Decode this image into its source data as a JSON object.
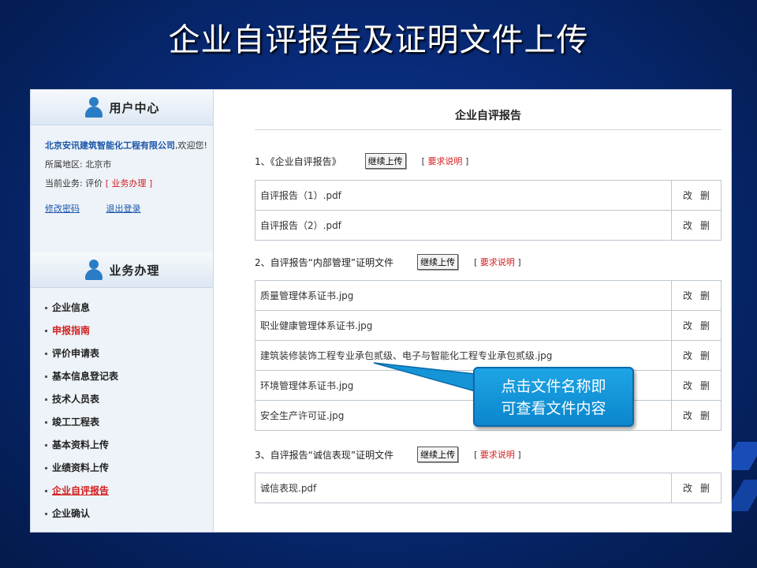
{
  "slide": {
    "title": "企业自评报告及证明文件上传"
  },
  "sidebar": {
    "user_center": {
      "title": "用户中心",
      "company": "北京安讯建筑智能化工程有限公司",
      "welcome": ",欢迎您!",
      "region_label": "所属地区:",
      "region_value": "北京市",
      "business_label": "当前业务:",
      "business_value": "评价",
      "business_link": "业务办理",
      "change_password": "修改密码",
      "logout": "退出登录"
    },
    "business": {
      "title": "业务办理",
      "items": [
        {
          "label": "企业信息"
        },
        {
          "label": "申报指南"
        },
        {
          "label": "评价申请表"
        },
        {
          "label": "基本信息登记表"
        },
        {
          "label": "技术人员表"
        },
        {
          "label": "竣工工程表"
        },
        {
          "label": "基本资料上传"
        },
        {
          "label": "业绩资料上传"
        },
        {
          "label": "企业自评报告"
        },
        {
          "label": "企业确认"
        }
      ]
    }
  },
  "content": {
    "title": "企业自评报告",
    "upload_btn": "继续上传",
    "req_prefix": "[",
    "req_label": "要求说明",
    "req_suffix": "]",
    "edit": "改",
    "delete": "删",
    "sections": [
      {
        "heading": "1、《企业自评报告》",
        "files": [
          "自评报告（1）.pdf",
          "自评报告（2）.pdf"
        ]
      },
      {
        "heading": "2、自评报告“内部管理”证明文件",
        "files": [
          "质量管理体系证书.jpg",
          "职业健康管理体系证书.jpg",
          "建筑装修装饰工程专业承包贰级、电子与智能化工程专业承包贰级.jpg",
          "环境管理体系证书.jpg",
          "安全生产许可证.jpg"
        ]
      },
      {
        "heading": "3、自评报告“诚信表现”证明文件",
        "files": [
          "诚信表现.pdf"
        ]
      }
    ]
  },
  "callout": {
    "line1": "点击文件名称即",
    "line2": "可查看文件内容"
  },
  "colors": {
    "background": "#082a78",
    "accent_red": "#d21f1f",
    "link_blue": "#1a56a8",
    "callout": "#1ea5e6"
  }
}
